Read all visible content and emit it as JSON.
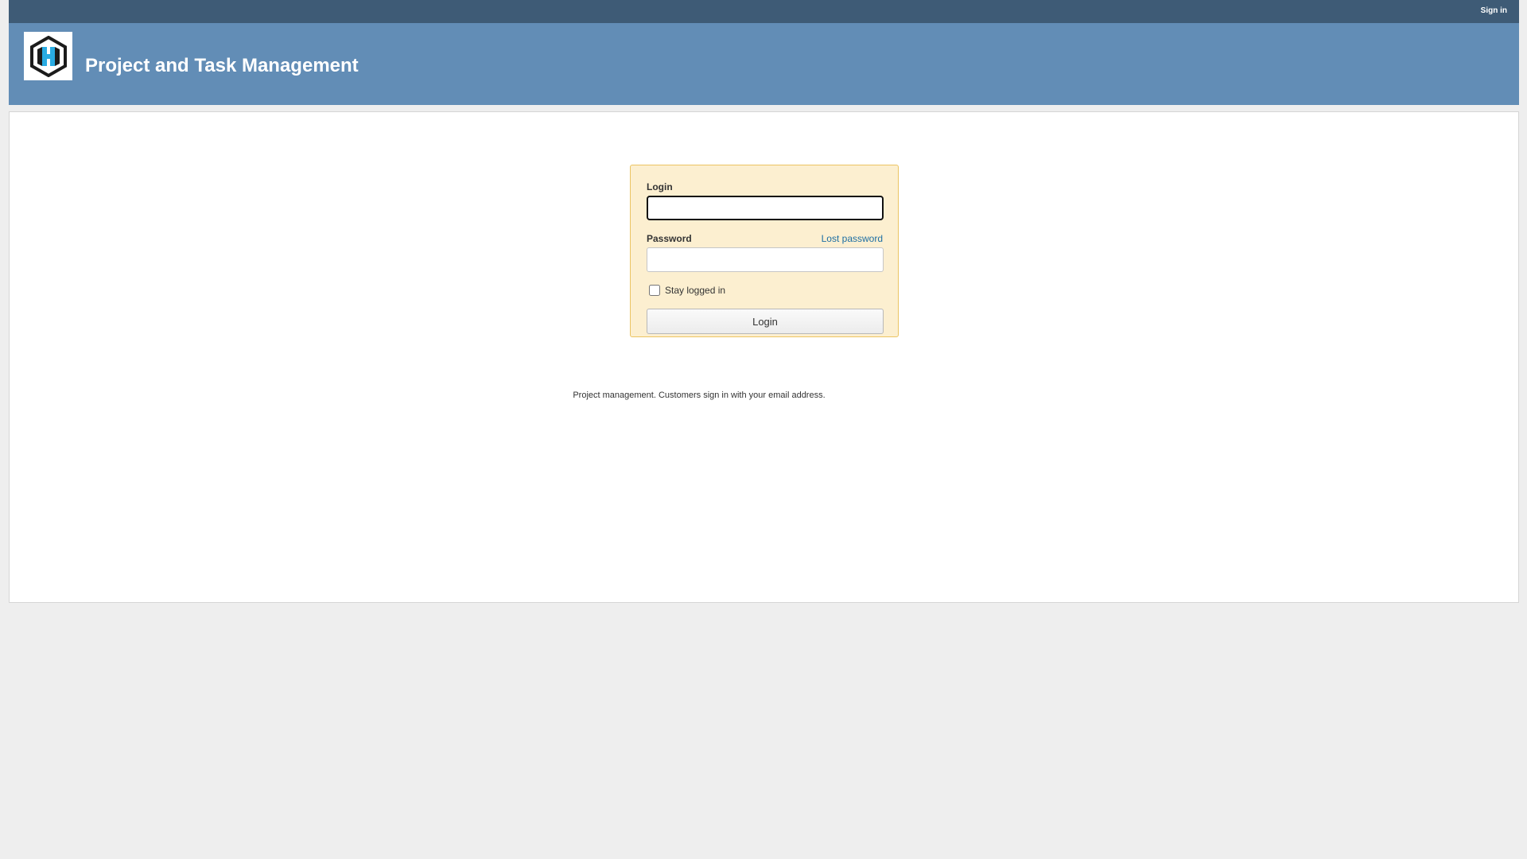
{
  "top_menu": {
    "account_link": "Sign in"
  },
  "header": {
    "title": "Project and Task Management",
    "logo_icon": "hexagon-logo-icon"
  },
  "login_form": {
    "login_label": "Login",
    "login_value": "",
    "password_label": "Password",
    "password_value": "",
    "lost_password_link": "Lost password",
    "remember_label": "Stay logged in",
    "remember_checked": false,
    "submit_label": "Login"
  },
  "welcome_text": "Project management. Customers sign in with your email address.",
  "colors": {
    "top_menu_bg": "#3e5b76",
    "header_bg": "#628db6",
    "login_box_bg": "#fcefd0",
    "login_box_border": "#ebc462",
    "link_color": "#1d6ea3",
    "page_bg": "#eeeeee"
  }
}
